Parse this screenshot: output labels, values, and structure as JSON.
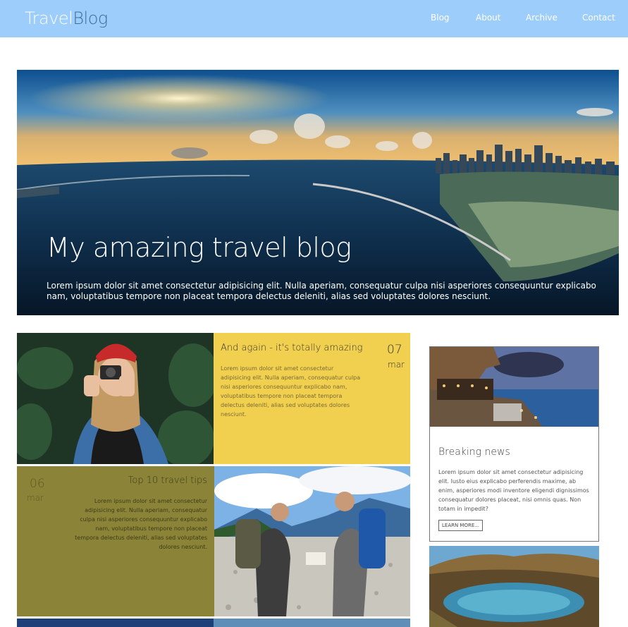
{
  "header": {
    "logo_part1": "Travel",
    "logo_part2": "Blog",
    "nav": [
      "Blog",
      "About",
      "Archive",
      "Contact"
    ]
  },
  "hero": {
    "title": "My amazing travel blog",
    "text": "Lorem ipsum dolor sit amet consectetur adipisicing elit. Nulla aperiam, consequatur culpa nisi asperiores consequuntur explicabo nam, voluptatibus tempore non placeat tempora delectus deleniti, alias sed voluptates dolores nesciunt."
  },
  "posts": [
    {
      "title": "And again - it's totally amazing",
      "day": "07",
      "month": "mar",
      "text": "Lorem ipsum dolor sit amet consectetur adipisicing elit. Nulla aperiam, consequatur culpa nisi asperiores consequuntur explicabo nam, voluptatibus tempore non placeat tempora delectus deleniti, alias sed voluptates dolores nesciunt."
    },
    {
      "title": "Top 10 travel tips",
      "day": "06",
      "month": "mar",
      "text": "Lorem ipsum dolor sit amet consectetur adipisicing elit. Nulla aperiam, consequatur culpa nisi asperiores consequuntur explicabo nam, voluptatibus tempore non placeat tempora delectus deleniti, alias sed voluptates dolores nesciunt."
    }
  ],
  "sidebar": {
    "news_title": "Breaking news",
    "news_text": "Lorem ipsum dolor sit amet consectetur adipisicing elit. Iusto eius explicabo perferendis maxime, ab enim, asperiores modi inventore eligendi dignissimos consequatur dolores placeat, nisi omnis quas. Non totam in impedit?",
    "button_label": "LEARN MORE..."
  },
  "colors": {
    "header_bg": "#9dcdfb",
    "yellow_tile": "#f2d04f",
    "olive_tile": "#8b8438"
  }
}
